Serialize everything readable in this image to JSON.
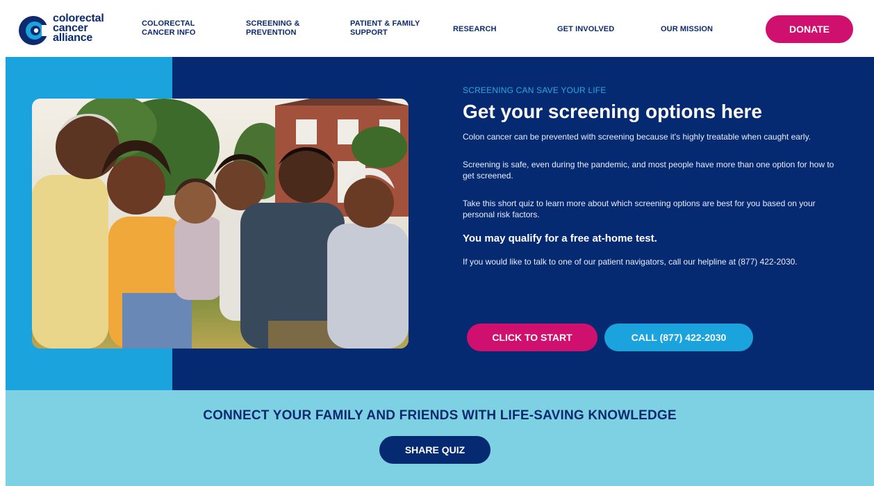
{
  "brand": {
    "name_line1": "colorectal",
    "name_line2": "cancer",
    "name_line3": "alliance",
    "color_navy": "#0b2a6f",
    "color_magenta": "#d0106e",
    "color_sky": "#1aa3dc",
    "color_light_band": "#7ed1e3",
    "color_hero_bg": "#062a72"
  },
  "nav": {
    "items": [
      {
        "line1": "COLORECTAL",
        "line2": "CANCER INFO"
      },
      {
        "line1": "SCREENING &",
        "line2": "PREVENTION"
      },
      {
        "line1": "PATIENT & FAMILY",
        "line2": "SUPPORT"
      },
      {
        "line1": "RESEARCH",
        "line2": ""
      },
      {
        "line1": "GET INVOLVED",
        "line2": ""
      },
      {
        "line1": "OUR MISSION",
        "line2": ""
      }
    ],
    "donate_label": "DONATE"
  },
  "hero": {
    "eyebrow": "SCREENING CAN SAVE YOUR LIFE",
    "title": "Get your screening options here",
    "paragraph1": "Colon cancer can be prevented with screening because it's highly treatable when caught early.",
    "paragraph2": "Screening is safe, even during the pandemic, and most people have more than one option for how to get screened.",
    "paragraph3": "Take this short quiz to learn more about which screening options are best for you based on your personal risk factors.",
    "highlight": "You may qualify for a free at-home test.",
    "paragraph4": "If you would like to talk to one of our patient navigators, call our helpline at (877) 422-2030.",
    "start_button": "CLICK TO START",
    "call_button": "CALL (877) 422-2030",
    "photo_icon": "family-photo"
  },
  "band": {
    "title": "CONNECT YOUR FAMILY AND FRIENDS WITH LIFE-SAVING KNOWLEDGE",
    "share_button": "SHARE QUIZ"
  }
}
